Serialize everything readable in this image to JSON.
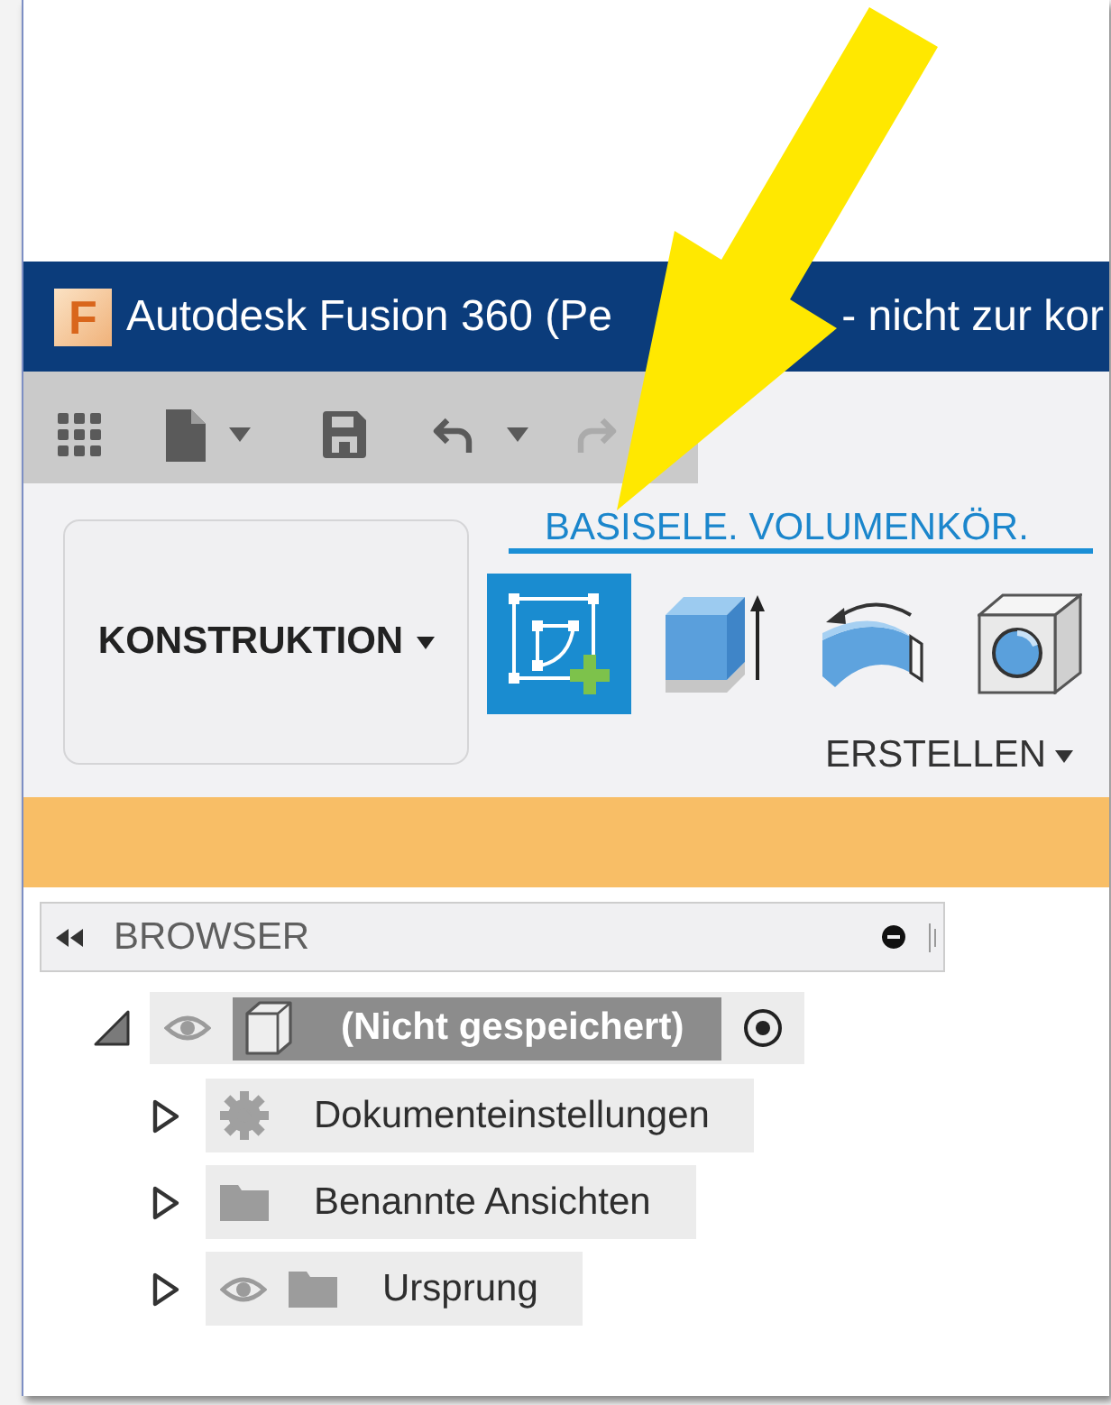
{
  "window": {
    "logo_letter": "F",
    "title_parts": [
      "Autodesk Fusion 360 (Pe",
      "- nicht zur kor"
    ]
  },
  "quick_access_toolbar": [
    {
      "dropdown": false,
      "disabled": false
    },
    {
      "dropdown": true,
      "disabled": false
    },
    {
      "dropdown": false,
      "disabled": false
    },
    {
      "dropdown": true,
      "disabled": false
    },
    {
      "dropdown": false,
      "disabled": true
    }
  ],
  "workspace_menu": {
    "label": "KONSTRUKTION"
  },
  "ribbon": {
    "tabs": [
      {
        "label": "BASISELE. VOLUMENKÖR.",
        "selected": true
      }
    ],
    "tools": [
      {
        "selected": true
      },
      {
        "selected": false
      },
      {
        "selected": false
      },
      {
        "selected": false
      }
    ],
    "panel_menu": {
      "label": "ERSTELLEN"
    }
  },
  "browser": {
    "title": "BROWSER",
    "tree": [
      {
        "kind": "component",
        "label": "(Nicht gespeichert)",
        "expanded": true,
        "selected": true,
        "visibility_toggle": true,
        "active": true,
        "children": [
          {
            "kind": "settings",
            "label": "Dokumenteinstellungen",
            "expanded": false,
            "selected": false,
            "visibility_toggle": false,
            "active": false
          },
          {
            "kind": "folder",
            "label": "Benannte Ansichten",
            "expanded": false,
            "selected": false,
            "visibility_toggle": false,
            "active": false
          },
          {
            "kind": "folder",
            "label": "Ursprung",
            "expanded": false,
            "selected": false,
            "visibility_toggle": true,
            "active": false
          }
        ]
      }
    ]
  }
}
